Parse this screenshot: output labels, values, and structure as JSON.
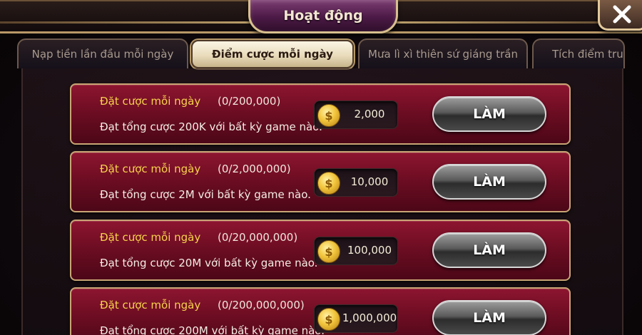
{
  "window": {
    "title": "Hoạt động",
    "close_icon": "close-icon"
  },
  "tabs": [
    {
      "label": "Nạp tiền lần đầu mỗi ngày",
      "active": false
    },
    {
      "label": "Điểm cược mỗi ngày",
      "active": true
    },
    {
      "label": "Mưa lì xì thiên sứ giáng trần",
      "active": false
    },
    {
      "label": "Tích điểm tru",
      "active": false
    }
  ],
  "tasks": [
    {
      "title": "Đặt cược mỗi ngày",
      "progress": "(0/200,000)",
      "description": "Đạt tổng cược 200K với bất kỳ game nào.",
      "coin_symbol": "$",
      "reward": "2,000",
      "button_label": "LÀM"
    },
    {
      "title": "Đặt cược mỗi ngày",
      "progress": "(0/2,000,000)",
      "description": "Đạt tổng cược 2M với bất kỳ game nào.",
      "coin_symbol": "$",
      "reward": "10,000",
      "button_label": "LÀM"
    },
    {
      "title": "Đặt cược mỗi ngày",
      "progress": "(0/20,000,000)",
      "description": "Đạt tổng cược 20M với bất kỳ game nào.",
      "coin_symbol": "$",
      "reward": "100,000",
      "button_label": "LÀM"
    },
    {
      "title": "Đặt cược mỗi ngày",
      "progress": "(0/200,000,000)",
      "description": "Đạt tổng cược 200M với bất kỳ game nào.",
      "coin_symbol": "$",
      "reward": "1,000,000",
      "button_label": "LÀM"
    }
  ],
  "colors": {
    "row_fill": "#7a1028",
    "row_border": "#c9a574",
    "title_yellow": "#f7d24a",
    "tab_active": "#f3ead3",
    "plate_purple": "#5a2253"
  }
}
